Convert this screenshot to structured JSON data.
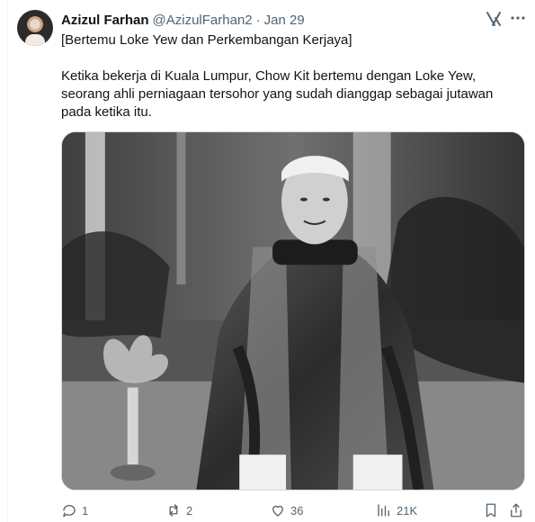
{
  "tweet": {
    "display_name": "Azizul Farhan",
    "handle": "@AzizulFarhan2",
    "separator": "·",
    "date": "Jan 29",
    "title": "[Bertemu Loke Yew dan Perkembangan Kerjaya]",
    "body": "Ketika bekerja di Kuala Lumpur, Chow Kit bertemu dengan Loke Yew, seorang ahli perniagaan tersohor yang sudah dianggap sebagai jutawan pada ketika itu."
  },
  "metrics": {
    "replies": "1",
    "reposts": "2",
    "likes": "36",
    "views": "21K"
  },
  "icons": {
    "avatar": "avatar",
    "grok": "grok-icon",
    "more": "more-icon",
    "reply": "reply-icon",
    "repost": "repost-icon",
    "like": "like-icon",
    "views": "views-icon",
    "bookmark": "bookmark-icon",
    "share": "share-icon"
  },
  "colors": {
    "primary_text": "#0f1419",
    "secondary_text": "#536471",
    "divider": "#eff3f4",
    "media_border": "#cfd9de"
  }
}
